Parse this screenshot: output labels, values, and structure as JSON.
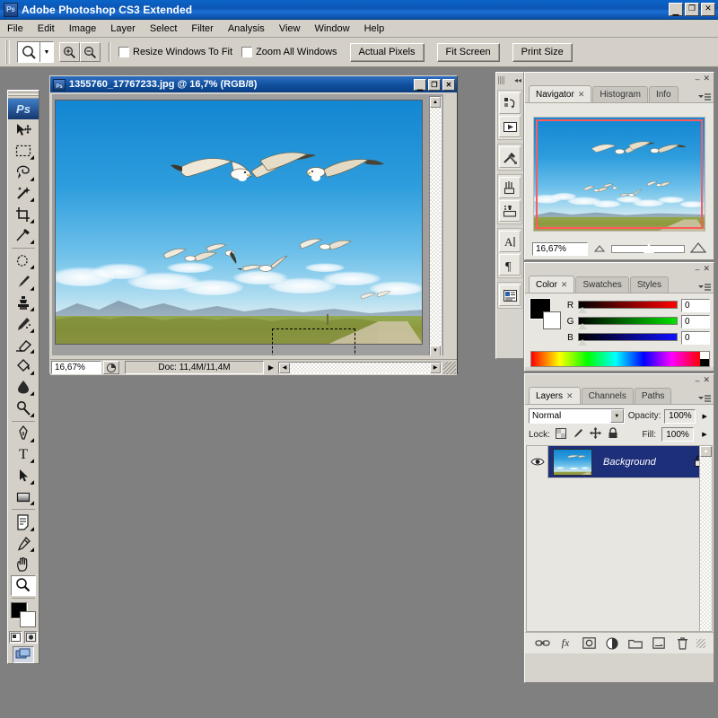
{
  "app": {
    "title": "Adobe Photoshop CS3 Extended",
    "logo_text": "Ps",
    "window_controls": {
      "minimize": "_",
      "maximize": "□",
      "close": "✕"
    }
  },
  "menubar": {
    "items": [
      "File",
      "Edit",
      "Image",
      "Layer",
      "Select",
      "Filter",
      "Analysis",
      "View",
      "Window",
      "Help"
    ]
  },
  "options_bar": {
    "active_tool": "zoom-tool",
    "checkboxes": [
      {
        "label": "Resize Windows To Fit",
        "checked": false
      },
      {
        "label": "Zoom All Windows",
        "checked": false
      }
    ],
    "buttons": [
      "Actual Pixels",
      "Fit Screen",
      "Print Size"
    ]
  },
  "toolbox": {
    "logo": "Ps",
    "tools": [
      {
        "name": "move-tool",
        "glyph": "✥",
        "selected": false,
        "has_flyout": false
      },
      {
        "name": "marquee-tool",
        "glyph": "▭",
        "selected": false,
        "has_flyout": true
      },
      {
        "name": "lasso-tool",
        "glyph": "◺",
        "selected": false,
        "has_flyout": true
      },
      {
        "name": "magic-wand-tool",
        "glyph": "✳",
        "selected": false,
        "has_flyout": true
      },
      {
        "name": "crop-tool",
        "glyph": "⌗",
        "selected": false,
        "has_flyout": true
      },
      {
        "name": "slice-tool",
        "glyph": "✂",
        "selected": false,
        "has_flyout": true
      },
      {
        "name": "healing-brush-tool",
        "glyph": "✒",
        "selected": false,
        "has_flyout": true
      },
      {
        "name": "brush-tool",
        "glyph": "🖌",
        "selected": false,
        "has_flyout": true
      },
      {
        "name": "clone-stamp-tool",
        "glyph": "⎙",
        "selected": false,
        "has_flyout": true
      },
      {
        "name": "history-brush-tool",
        "glyph": "✎",
        "selected": false,
        "has_flyout": true
      },
      {
        "name": "eraser-tool",
        "glyph": "▱",
        "selected": false,
        "has_flyout": true
      },
      {
        "name": "gradient-tool",
        "glyph": "◨",
        "selected": false,
        "has_flyout": true
      },
      {
        "name": "blur-tool",
        "glyph": "💧",
        "selected": false,
        "has_flyout": true
      },
      {
        "name": "dodge-tool",
        "glyph": "◓",
        "selected": false,
        "has_flyout": true
      },
      {
        "name": "pen-tool",
        "glyph": "✐",
        "selected": false,
        "has_flyout": true
      },
      {
        "name": "type-tool",
        "glyph": "T",
        "selected": false,
        "has_flyout": true
      },
      {
        "name": "path-selection-tool",
        "glyph": "➤",
        "selected": false,
        "has_flyout": true
      },
      {
        "name": "rectangle-shape-tool",
        "glyph": "▣",
        "selected": false,
        "has_flyout": true
      },
      {
        "name": "notes-tool",
        "glyph": "🗎",
        "selected": false,
        "has_flyout": true
      },
      {
        "name": "eyedropper-tool",
        "glyph": "⌖",
        "selected": false,
        "has_flyout": true
      },
      {
        "name": "hand-tool",
        "glyph": "✋",
        "selected": false,
        "has_flyout": false
      },
      {
        "name": "zoom-tool",
        "glyph": "🔍",
        "selected": true,
        "has_flyout": false
      }
    ],
    "foreground_color": "#000000",
    "background_color": "#ffffff",
    "quick_mask": {
      "standard_selected": true,
      "quickmask_selected": false
    },
    "screen_mode": "standard-screen-mode"
  },
  "document": {
    "title": "1355760_17767233.jpg @ 16,7% (RGB/8)",
    "window_controls": {
      "minimize": "_",
      "maximize": "□",
      "close": "✕"
    },
    "status": {
      "zoom": "16,67%",
      "doc_info": "Doc: 11,4M/11,4M"
    },
    "selection_marquee": {
      "visible": true
    },
    "cursor": "zoom-in-cursor"
  },
  "icon_strip": {
    "buttons": [
      {
        "name": "history-panel-icon",
        "glyph": "⟲"
      },
      {
        "name": "actions-panel-icon",
        "glyph": "▶"
      },
      {
        "name": "tool-presets-panel-icon",
        "glyph": "⚒"
      },
      {
        "name": "brushes-panel-icon",
        "glyph": "🖌"
      },
      {
        "name": "clone-source-panel-icon",
        "glyph": "⎘"
      },
      {
        "name": "character-panel-icon",
        "glyph": "A"
      },
      {
        "name": "paragraph-panel-icon",
        "glyph": "¶"
      },
      {
        "name": "layer-comps-panel-icon",
        "glyph": "▤"
      }
    ],
    "collapse_label": "◂◂"
  },
  "navigator_panel": {
    "tabs": [
      {
        "label": "Navigator",
        "active": true,
        "closable": true
      },
      {
        "label": "Histogram",
        "active": false,
        "closable": false
      },
      {
        "label": "Info",
        "active": false,
        "closable": false
      }
    ],
    "zoom_value": "16,67%",
    "zoom_out_icon": "small-mountain-icon",
    "zoom_in_icon": "large-mountain-icon",
    "view_box_color": "#ff5a5a"
  },
  "color_panel": {
    "tabs": [
      {
        "label": "Color",
        "active": true,
        "closable": true
      },
      {
        "label": "Swatches",
        "active": false,
        "closable": false
      },
      {
        "label": "Styles",
        "active": false,
        "closable": false
      }
    ],
    "foreground_color": "#000000",
    "background_color": "#ffffff",
    "channels": [
      {
        "label": "R",
        "value": "0",
        "bar_from": "#000000",
        "bar_to": "#ff0000"
      },
      {
        "label": "G",
        "value": "0",
        "bar_from": "#000000",
        "bar_to": "#00ff00"
      },
      {
        "label": "B",
        "value": "0",
        "bar_from": "#000000",
        "bar_to": "#0000ff"
      }
    ]
  },
  "layers_panel": {
    "tabs": [
      {
        "label": "Layers",
        "active": true,
        "closable": true
      },
      {
        "label": "Channels",
        "active": false,
        "closable": false
      },
      {
        "label": "Paths",
        "active": false,
        "closable": false
      }
    ],
    "blend_mode": "Normal",
    "opacity_label": "Opacity:",
    "opacity_value": "100%",
    "lock_label": "Lock:",
    "fill_label": "Fill:",
    "fill_value": "100%",
    "lock_icons": [
      {
        "name": "lock-transparent-pixels-icon",
        "glyph": "▨"
      },
      {
        "name": "lock-image-pixels-icon",
        "glyph": "🖌"
      },
      {
        "name": "lock-position-icon",
        "glyph": "✥"
      },
      {
        "name": "lock-all-icon",
        "glyph": "🔒"
      }
    ],
    "layers": [
      {
        "name": "Background",
        "visible": true,
        "locked": true,
        "selected": true
      }
    ],
    "footer_buttons": [
      {
        "name": "link-layers-icon",
        "glyph": "🔗"
      },
      {
        "name": "layer-style-fx-icon",
        "glyph": "fx"
      },
      {
        "name": "add-layer-mask-icon",
        "glyph": "◍"
      },
      {
        "name": "new-adjustment-layer-icon",
        "glyph": "◑"
      },
      {
        "name": "new-group-icon",
        "glyph": "🗀"
      },
      {
        "name": "new-layer-icon",
        "glyph": "❐"
      },
      {
        "name": "delete-layer-icon",
        "glyph": "🗑"
      }
    ]
  },
  "panel_header_controls": {
    "minimize": "–",
    "close": "✕",
    "menu": "▾☰"
  }
}
